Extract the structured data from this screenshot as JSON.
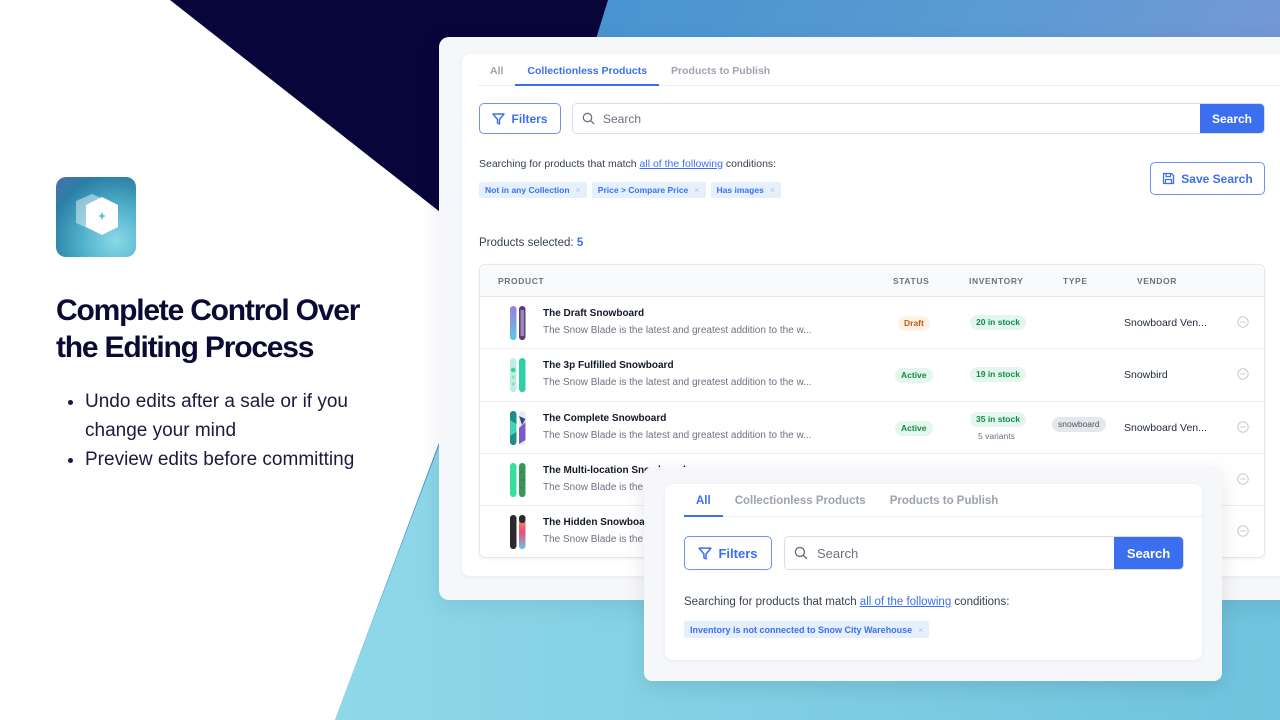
{
  "marketing": {
    "headline_line1": "Complete Control Over",
    "headline_line2": "the Editing Process",
    "bullets": [
      "Undo edits after a sale or if you change your mind",
      "Preview edits before committing"
    ]
  },
  "colors": {
    "accent": "#3b6ff0",
    "navy": "#07053a",
    "draft_text": "#c2571a",
    "active_text": "#148a4a"
  },
  "main_panel": {
    "tabs": [
      {
        "label": "All",
        "active": false
      },
      {
        "label": "Collectionless Products",
        "active": true
      },
      {
        "label": "Products to Publish",
        "active": false
      }
    ],
    "filters_label": "Filters",
    "search_placeholder": "Search",
    "search_button": "Search",
    "conditions_prefix": "Searching for products that match",
    "conditions_link": "all of the following",
    "conditions_suffix": "conditions:",
    "chips": [
      "Not in any Collection",
      "Price > Compare Price",
      "Has images"
    ],
    "save_search_label": "Save Search",
    "selected_label": "Products selected:",
    "selected_count": "5",
    "table": {
      "headers": {
        "product": "PRODUCT",
        "status": "STATUS",
        "inventory": "INVENTORY",
        "type": "TYPE",
        "vendor": "VENDOR"
      },
      "rows": [
        {
          "name": "The Draft Snowboard",
          "desc": "The Snow Blade is the latest and greatest addition to the w...",
          "status": "Draft",
          "inventory": "20 in stock",
          "variants": "",
          "type": "",
          "vendor": "Snowboard Ven..."
        },
        {
          "name": "The 3p Fulfilled Snowboard",
          "desc": "The Snow Blade is the latest and greatest addition to the w...",
          "status": "Active",
          "inventory": "19 in stock",
          "variants": "",
          "type": "",
          "vendor": "Snowbird"
        },
        {
          "name": "The Complete Snowboard",
          "desc": "The Snow Blade is the latest and greatest addition to the w...",
          "status": "Active",
          "inventory": "35 in stock",
          "variants": "5 variants",
          "type": "snowboard",
          "vendor": "Snowboard Ven..."
        },
        {
          "name": "The Multi-location Snowboard",
          "desc": "The Snow Blade is the latest and greatest addition to the w...",
          "status": "",
          "inventory": "",
          "variants": "",
          "type": "",
          "vendor": ""
        },
        {
          "name": "The Hidden Snowboard",
          "desc": "The Snow Blade is the latest and greatest addition to the w...",
          "status": "",
          "inventory": "",
          "variants": "",
          "type": "",
          "vendor": ""
        }
      ]
    }
  },
  "overlay_panel": {
    "tabs": [
      {
        "label": "All",
        "active": true
      },
      {
        "label": "Collectionless Products",
        "active": false
      },
      {
        "label": "Products to Publish",
        "active": false
      }
    ],
    "filters_label": "Filters",
    "search_placeholder": "Search",
    "search_button": "Search",
    "conditions_prefix": "Searching for products that match",
    "conditions_link": "all of the following",
    "conditions_suffix": "conditions:",
    "chips": [
      "Inventory is not connected to Snow City Warehouse"
    ]
  }
}
